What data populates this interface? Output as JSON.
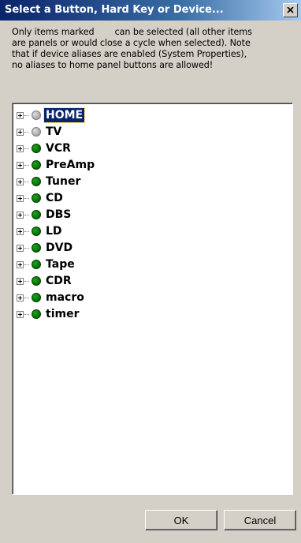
{
  "window": {
    "title": "Select a Button, Hard Key or Device...",
    "close_icon": "close-icon"
  },
  "description": {
    "line1_a": "Only items marked",
    "line1_b": "can be selected (all other items",
    "line2": "are panels or would close a cycle when selected). Note",
    "line3": "that if device aliases are enabled (System Properties),",
    "line4": "no aliases to home panel buttons are allowed!"
  },
  "tree": {
    "items": [
      {
        "label": "HOME",
        "status": "gray",
        "selected": true
      },
      {
        "label": "TV",
        "status": "gray",
        "selected": false
      },
      {
        "label": "VCR",
        "status": "green",
        "selected": false
      },
      {
        "label": "PreAmp",
        "status": "green",
        "selected": false
      },
      {
        "label": "Tuner",
        "status": "green",
        "selected": false
      },
      {
        "label": "CD",
        "status": "green",
        "selected": false
      },
      {
        "label": "DBS",
        "status": "green",
        "selected": false
      },
      {
        "label": "LD",
        "status": "green",
        "selected": false
      },
      {
        "label": "DVD",
        "status": "green",
        "selected": false
      },
      {
        "label": "Tape",
        "status": "green",
        "selected": false
      },
      {
        "label": "CDR",
        "status": "green",
        "selected": false
      },
      {
        "label": "macro",
        "status": "green",
        "selected": false
      },
      {
        "label": "timer",
        "status": "green",
        "selected": false
      }
    ]
  },
  "buttons": {
    "ok_label": "OK",
    "cancel_label": "Cancel"
  },
  "colors": {
    "title_bar": "#0a246a",
    "dialog_bg": "#d4d0c8",
    "status_green": "#007000",
    "status_gray": "#a0a0a0",
    "selection": "#0a246a"
  }
}
